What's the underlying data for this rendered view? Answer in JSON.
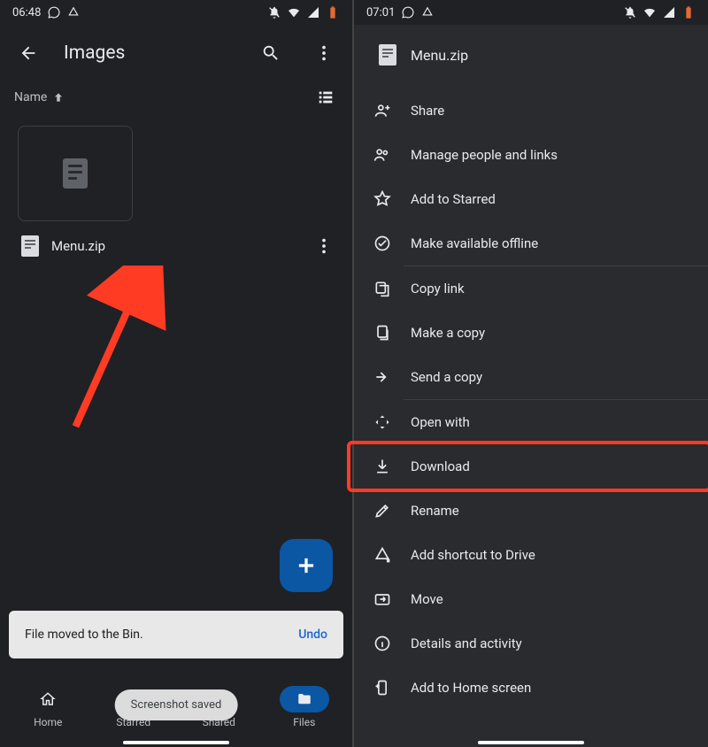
{
  "left": {
    "status": {
      "time": "06:48"
    },
    "appbar": {
      "title": "Images"
    },
    "sort": {
      "label": "Name"
    },
    "file": {
      "name": "Menu.zip"
    },
    "snackbar": {
      "message": "File moved to the Bin.",
      "action": "Undo"
    },
    "screenshot_toast": "Screenshot saved",
    "nav": {
      "items": [
        {
          "label": "Home"
        },
        {
          "label": "Starred"
        },
        {
          "label": "Shared"
        },
        {
          "label": "Files"
        }
      ]
    }
  },
  "right": {
    "status": {
      "time": "07:01"
    },
    "sheet": {
      "filename": "Menu.zip",
      "items": [
        {
          "label": "Share"
        },
        {
          "label": "Manage people and links"
        },
        {
          "label": "Add to Starred"
        },
        {
          "label": "Make available offline"
        },
        {
          "label": "Copy link"
        },
        {
          "label": "Make a copy"
        },
        {
          "label": "Send a copy"
        },
        {
          "label": "Open with"
        },
        {
          "label": "Download"
        },
        {
          "label": "Rename"
        },
        {
          "label": "Add shortcut to Drive"
        },
        {
          "label": "Move"
        },
        {
          "label": "Details and activity"
        },
        {
          "label": "Add to Home screen"
        }
      ]
    }
  }
}
